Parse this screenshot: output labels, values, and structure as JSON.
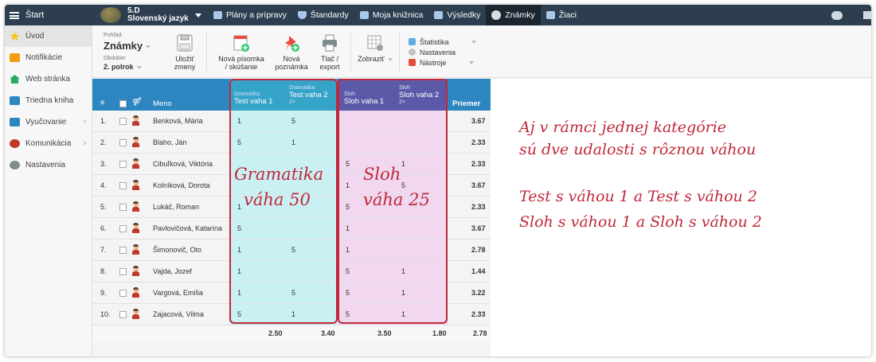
{
  "topbar": {
    "start_label": "Štart",
    "class_name": "5.D",
    "subject": "Slovenský jazyk",
    "nav": [
      {
        "label": "Plány a prípravy",
        "icon": "folder-icon"
      },
      {
        "label": "Štandardy",
        "icon": "shield-icon"
      },
      {
        "label": "Moja knižnica",
        "icon": "library-icon"
      },
      {
        "label": "Výsledky",
        "icon": "bar-chart-icon"
      },
      {
        "label": "Známky",
        "icon": "grade-icon",
        "active": true
      },
      {
        "label": "Žiaci",
        "icon": "students-icon"
      }
    ]
  },
  "sidebar": {
    "items": [
      {
        "label": "Úvod",
        "icon": "star-icon",
        "color": "#f5c518",
        "active": true
      },
      {
        "label": "Notifikácie",
        "icon": "mail-icon",
        "color": "#f39c12"
      },
      {
        "label": "Web stránka",
        "icon": "home-icon",
        "color": "#27ae60"
      },
      {
        "label": "Triedna kniha",
        "icon": "book-icon",
        "color": "#2e86c1"
      },
      {
        "label": "Vyučovanie",
        "icon": "briefcase-icon",
        "color": "#2e86c1",
        "chevron": ">"
      },
      {
        "label": "Komunikácia",
        "icon": "chat-icon",
        "color": "#c0392b",
        "chevron": ">"
      },
      {
        "label": "Nastavenia",
        "icon": "gear-icon",
        "color": "#7f8c8d"
      }
    ]
  },
  "toolbar": {
    "view_small": "Pohľad:",
    "view_value": "Známky",
    "period_small": "Obdobie:",
    "period_value": "2. polrok",
    "save_line1": "Uložiť",
    "save_line2": "zmeny",
    "new_test_line1": "Nová písomka",
    "new_test_line2": "/ skúšanie",
    "new_note_line1": "Nová",
    "new_note_line2": "poznámka",
    "print_line1": "Tlač /",
    "print_line2": "export",
    "display_label": "Zobraziť",
    "menu_stats": "Štatistika",
    "menu_settings": "Nastavenia",
    "menu_tools": "Nástroje"
  },
  "table": {
    "col_num": "#",
    "col_name": "Meno",
    "col_avg": "Priemer",
    "events": [
      {
        "category": "Gramatika",
        "name": "Test vaha 1",
        "mult": ""
      },
      {
        "category": "Gramatika",
        "name": "Test vaha 2",
        "mult": "2×"
      },
      {
        "category": "Sloh",
        "name": "Sloh vaha 1",
        "mult": ""
      },
      {
        "category": "Sloh",
        "name": "Sloh vaha 2",
        "mult": "2×"
      }
    ],
    "rows": [
      {
        "num": "1.",
        "name": "Benková, Mária",
        "g1": "1",
        "g2": "5",
        "s1": "",
        "s2": "",
        "avg": "3.67"
      },
      {
        "num": "2.",
        "name": "Blaho, Ján",
        "g1": "5",
        "g2": "1",
        "s1": "",
        "s2": "",
        "avg": "2.33"
      },
      {
        "num": "3.",
        "name": "Cibuľková, Viktória",
        "g1": "",
        "g2": "",
        "s1": "5",
        "s2": "1",
        "avg": "2.33"
      },
      {
        "num": "4.",
        "name": "Kolníková, Dorota",
        "g1": "",
        "g2": "",
        "s1": "1",
        "s2": "5",
        "avg": "3.67"
      },
      {
        "num": "5.",
        "name": "Lukáč, Roman",
        "g1": "1",
        "g2": "",
        "s1": "5",
        "s2": "",
        "avg": "2.33"
      },
      {
        "num": "6.",
        "name": "Pavlovičová, Katarína",
        "g1": "5",
        "g2": "",
        "s1": "1",
        "s2": "",
        "avg": "3.67"
      },
      {
        "num": "7.",
        "name": "Šimonovič, Oto",
        "g1": "1",
        "g2": "5",
        "s1": "1",
        "s2": "",
        "avg": "2.78"
      },
      {
        "num": "8.",
        "name": "Vajda, Jozef",
        "g1": "1",
        "g2": "",
        "s1": "5",
        "s2": "1",
        "avg": "1.44"
      },
      {
        "num": "9.",
        "name": "Vargová, Emília",
        "g1": "1",
        "g2": "5",
        "s1": "5",
        "s2": "1",
        "avg": "3.22"
      },
      {
        "num": "10.",
        "name": "Zajacová, Vilma",
        "g1": "5",
        "g2": "1",
        "s1": "5",
        "s2": "1",
        "avg": "2.33"
      }
    ],
    "footer": {
      "g1": "2.50",
      "g2": "3.40",
      "s1": "3.50",
      "s2": "1.80",
      "avg": "2.78"
    }
  },
  "annotations": {
    "gram_line1": "Gramatika",
    "gram_line2": "váha 50",
    "sloh_line1": "Sloh",
    "sloh_line2": "váha 25",
    "note1_line1": "Aj v rámci jednej kategórie",
    "note1_line2": "sú dve udalosti s rôznou váhou",
    "note2_line1": "Test s váhou 1 a Test s váhou 2",
    "note2_line2": "Sloh s váhou 1 a Sloh s váhou 2",
    "accent_color": "#c0283a"
  }
}
